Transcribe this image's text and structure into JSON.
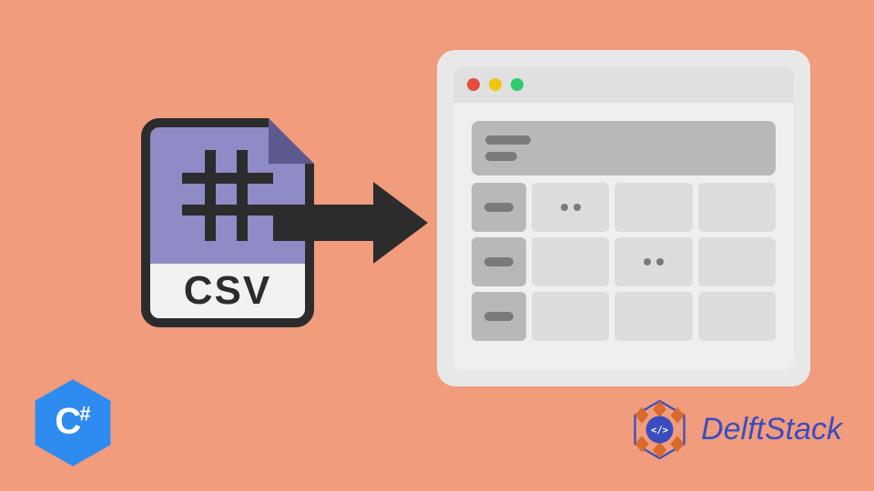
{
  "csv_icon": {
    "label": "CSV"
  },
  "csharp_logo": {
    "letter": "C",
    "sharp": "#",
    "color": "#2E8BEF"
  },
  "delftstack": {
    "name": "DelftStack",
    "code_symbol": "</>",
    "primary_color": "#3A4DBF",
    "accent_color": "#D96A2B"
  },
  "window": {
    "traffic_lights": [
      "red",
      "yellow",
      "green"
    ]
  }
}
